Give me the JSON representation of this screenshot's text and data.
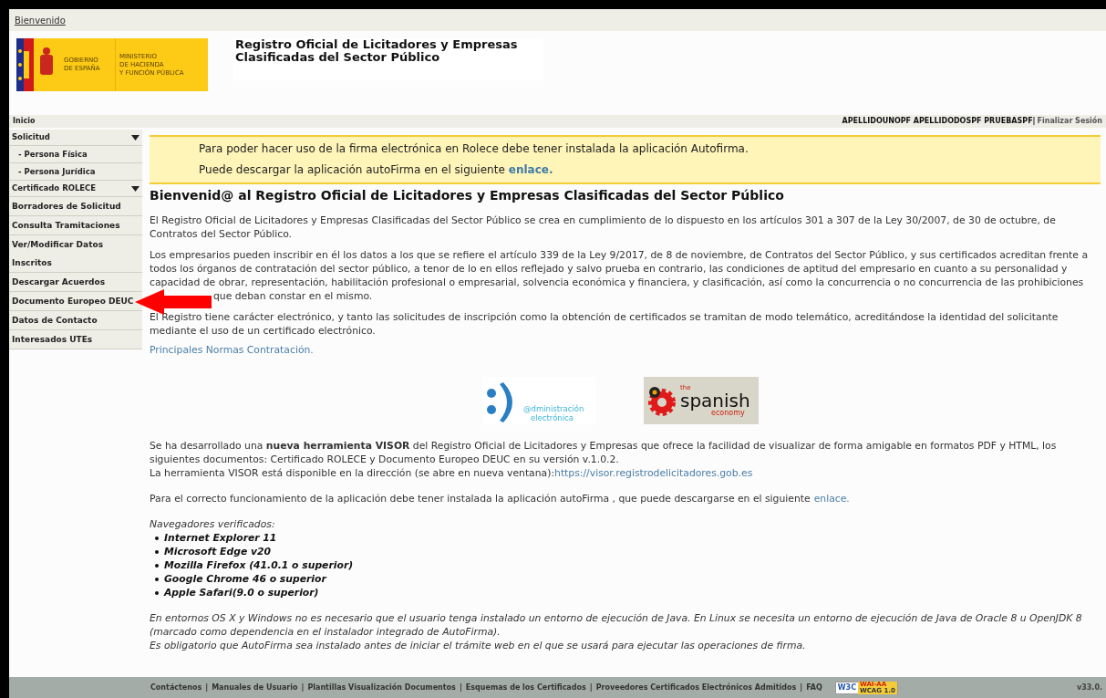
{
  "top_bar": {
    "link": "Bienvenido"
  },
  "header": {
    "gov_logo": {
      "line_1": "GOBIERNO",
      "line_2": "DE ESPAÑA",
      "ministry": [
        "MINISTERIO",
        "DE HACIENDA",
        "Y FUNCIÓN PÚBLICA"
      ]
    },
    "title": [
      "Registro Oficial de Licitadores y Empresas",
      "Clasificadas del Sector Público"
    ]
  },
  "breadcrumb": {
    "label": "Inicio",
    "user": "APELLIDOUNOPF APELLIDODOSPF PRUEBASPF|",
    "logout": "Finalizar Sesión"
  },
  "sidebar": {
    "items": [
      {
        "kind": "section",
        "label": "Solicitud",
        "expanded": true
      },
      {
        "kind": "sub",
        "label": "- Persona Física"
      },
      {
        "kind": "sub",
        "label": "- Persona Jurídica"
      },
      {
        "kind": "section",
        "label": "Certificado ROLECE",
        "expanded": true
      },
      {
        "kind": "item",
        "label": "Borradores de Solicitud"
      },
      {
        "kind": "item",
        "label": "Consulta Tramitaciones"
      },
      {
        "kind": "item",
        "label": "Ver/Modificar Datos Inscritos"
      },
      {
        "kind": "item",
        "label": "Descargar Acuerdos"
      },
      {
        "kind": "item",
        "label": "Documento Europeo DEUC",
        "pointed": true
      },
      {
        "kind": "item",
        "label": "Datos de Contacto"
      },
      {
        "kind": "item",
        "label": "Interesados UTEs"
      }
    ]
  },
  "notice": {
    "line_1": "Para poder hacer uso de la firma electrónica en Rolece debe tener instalada la aplicación Autofirma.",
    "line_2": "Puede descargar la aplicación autoFirma en el siguiente",
    "link": "enlace."
  },
  "main": {
    "heading": "Bienvenid@ al Registro Oficial de Licitadores y Empresas Clasificadas del Sector Público",
    "paragraphs": [
      "El Registro Oficial de Licitadores y Empresas Clasificadas del Sector Público se crea en cumplimiento de lo dispuesto en los artículos 301 a 307 de la Ley 30/2007, de 30 de octubre, de Contratos del Sector Público.",
      "Los empresarios pueden inscribir en él los datos a los que se refiere el artículo 339 de la Ley 9/2017, de 8 de noviembre, de Contratos del Sector Público, y sus certificados acreditan frente a todos los órganos de contratación del sector público, a tenor de lo en ellos reflejado y salvo prueba en contrario, las condiciones de aptitud del empresario en cuanto a su personalidad y capacidad de obrar, representación, habilitación profesional o empresarial, solvencia económica y financiera, y clasificación, así como la concurrencia o no concurrencia de las prohibiciones",
      "El Registro tiene carácter electrónico, y tanto las solicitudes de inscripción como la obtención de certificados se tramitan de modo telemático, acreditándose la identidad del solicitante mediante el uso de un certificado electrónico."
    ],
    "covered_line": "que deban constar en el mismo.",
    "norms_link": "Principales Normas Contratación.",
    "logos": {
      "admin": [
        "@dministración",
        "electrónica"
      ],
      "economy": [
        "the",
        "spanish",
        "economy"
      ]
    },
    "visor": {
      "text": "Se ha desarrollado una **nueva herramienta VISOR** del Registro Oficial de Licitadores y Empresas que ofrece la facilidad de visualizar de forma amigable en formatos PDF y HTML, los siguientes documentos: Certificado ROLECE y Documento Europeo DEUC en su versión v.1.0.2.",
      "address_text": "La herramienta VISOR está disponible en la dirección (se abre en nueva ventana):",
      "address_link": "https://visor.registrodelicitadores.gob.es"
    },
    "autofirma": {
      "text": "Para el correcto funcionamiento de la aplicación debe tener instalada la aplicación autoFirma , que puede descargarse en el siguiente",
      "link": "enlace."
    },
    "browsers": {
      "title": "Navegadores verificados:",
      "items": [
        "Internet Explorer 11",
        "Microsoft Edge v20",
        "Mozilla Firefox (41.0.1 o superior)",
        "Google Chrome 46 o superior",
        "Apple Safari(9.0 o superior)"
      ]
    },
    "notes": [
      "En entornos OS X y Windows no es necesario que el usuario tenga instalado un entorno de ejecución de Java. En Linux se necesita un entorno de ejecución de Java de Oracle 8 u OpenJDK 8 (marcado como dependencia en el instalador integrado de AutoFirma).",
      "Es obligatorio que AutoFirma sea instalado antes de iniciar el trámite web en el que se usará para ejecutar las operaciones de firma."
    ]
  },
  "footer": {
    "links": [
      "Contáctenos",
      "Manuales de Usuario",
      "Plantillas Visualización Documentos",
      "Esquemas de los Certificados",
      "Proveedores Certificados Electrónicos Admitidos",
      "FAQ"
    ],
    "separator": "|",
    "badge": {
      "w3c": "W3C",
      "wai": "WAI-AA",
      "wcag": "WCAG 1.0"
    },
    "version": "v33.0."
  }
}
